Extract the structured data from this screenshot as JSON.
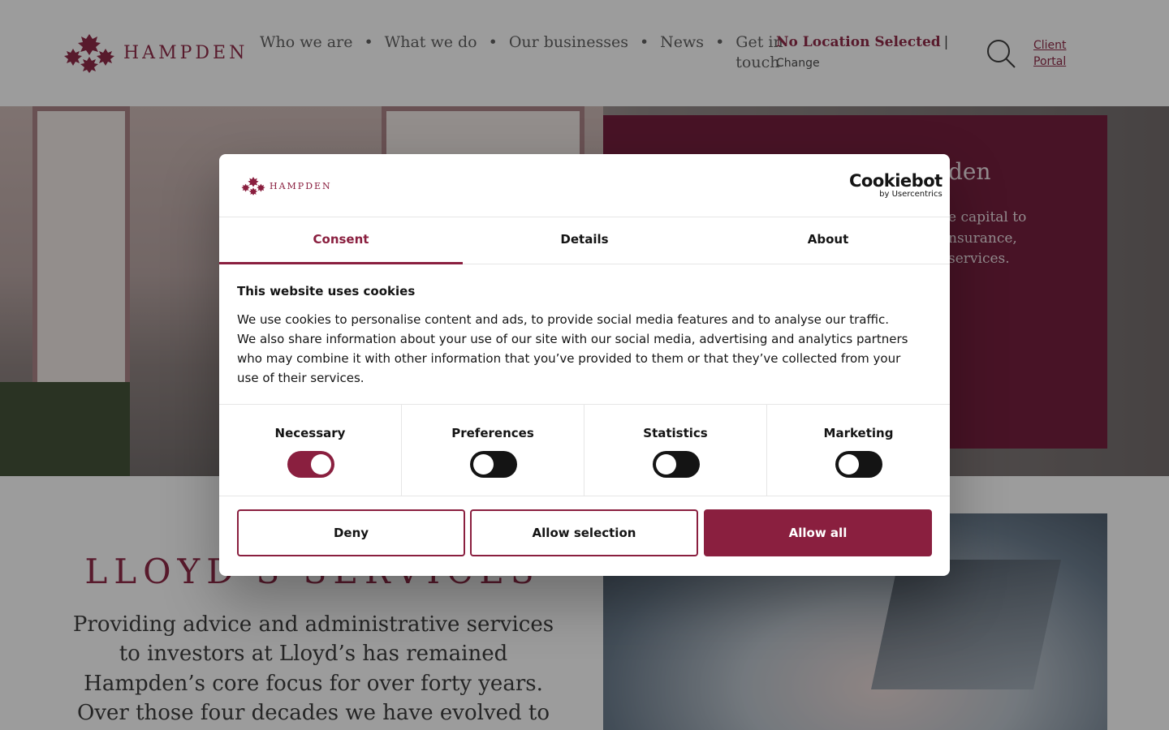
{
  "brand": {
    "name": "HAMPDEN",
    "accent": "#8a1f3f"
  },
  "nav": {
    "items": [
      "Who we are",
      "What we do",
      "Our businesses",
      "News",
      "Get in touch"
    ],
    "separator": "•"
  },
  "location": {
    "title": "No Location Selected",
    "pipe": "|",
    "change": "Change"
  },
  "header_icons": {
    "search": "search-icon"
  },
  "client_portal": "Client Portal",
  "hero": {
    "title_fragment": "den",
    "text_fragment": "e capital to\nnsurance,\nservices."
  },
  "section": {
    "title": "LLOYD'S SERVICES",
    "text": "Providing advice and administrative services to investors at Lloyd’s has remained Hampden’s core focus for over forty years. Over those four decades we have evolved to"
  },
  "cookie_dialog": {
    "logo": "HAMPDEN",
    "provider": {
      "name": "Cookiebot",
      "by": "by Usercentrics"
    },
    "tabs": [
      "Consent",
      "Details",
      "About"
    ],
    "active_tab": "Consent",
    "heading": "This website uses cookies",
    "text": "We use cookies to personalise content and ads, to provide social media features and to analyse our traffic. We also share information about your use of our site with our social media, advertising and analytics partners who may combine it with other information that you’ve provided to them or that they’ve collected from your use of their services.",
    "toggles": [
      {
        "label": "Necessary",
        "on": true
      },
      {
        "label": "Preferences",
        "on": false
      },
      {
        "label": "Statistics",
        "on": false
      },
      {
        "label": "Marketing",
        "on": false
      }
    ],
    "buttons": {
      "deny": "Deny",
      "allow_selection": "Allow selection",
      "allow_all": "Allow all"
    }
  }
}
